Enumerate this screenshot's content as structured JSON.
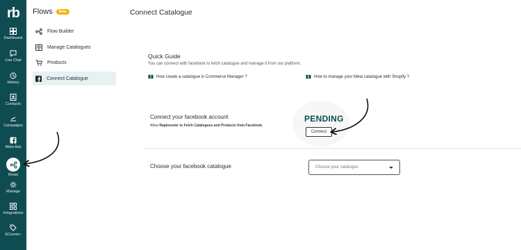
{
  "logo": "rb",
  "rail": {
    "items": [
      {
        "label": "Dashboard",
        "icon": "dashboard-icon"
      },
      {
        "label": "Live Chat",
        "icon": "chat-icon"
      },
      {
        "label": "History",
        "icon": "history-icon"
      },
      {
        "label": "Contacts",
        "icon": "contacts-icon"
      },
      {
        "label": "Campaigns",
        "icon": "campaigns-icon"
      },
      {
        "label": "Meta Ads",
        "icon": "facebook-icon"
      },
      {
        "label": "Flows",
        "icon": "flows-icon",
        "active": true
      },
      {
        "label": "Manage",
        "icon": "gear-icon"
      },
      {
        "label": "Integrations",
        "icon": "integrations-icon"
      },
      {
        "label": "EComm+",
        "icon": "tag-icon"
      }
    ]
  },
  "subnav": {
    "title": "Flows",
    "badge": "Beta",
    "items": [
      {
        "label": "Flow Builder",
        "icon": "flow-builder-icon"
      },
      {
        "label": "Manage Catalogues",
        "icon": "catalogue-icon"
      },
      {
        "label": "Products",
        "icon": "cart-icon"
      },
      {
        "label": "Connect Catalogue",
        "icon": "facebook-icon",
        "active": true
      }
    ]
  },
  "main": {
    "page_title": "Connect Catalogue",
    "quick_guide": {
      "title": "Quick Guide",
      "description": "You can connect with facebook to fetch catalogue and manage it from our platform.",
      "links": [
        {
          "label": "How create a catalogue in Commerce Manager ?",
          "icon": "book-icon"
        },
        {
          "label": "How to manage your Meta catalogue with Shopify ?",
          "icon": "book-icon"
        }
      ]
    },
    "facebook_account": {
      "title": "Connect your facebook account",
      "desc_prefix": "Allow",
      "desc_bold": "Rapbooster to Fetch Catalogues and Products from Facebook.",
      "status": "PENDING",
      "button": "Connect"
    },
    "catalogue": {
      "title": "Choose your facebook catalogue",
      "placeholder": "Choose your catalogue"
    }
  },
  "colors": {
    "rail_bg": "#0f4c52",
    "accent": "#0f4c52",
    "badge": "#f4b400",
    "active_item_bg": "#e6f2f2"
  }
}
